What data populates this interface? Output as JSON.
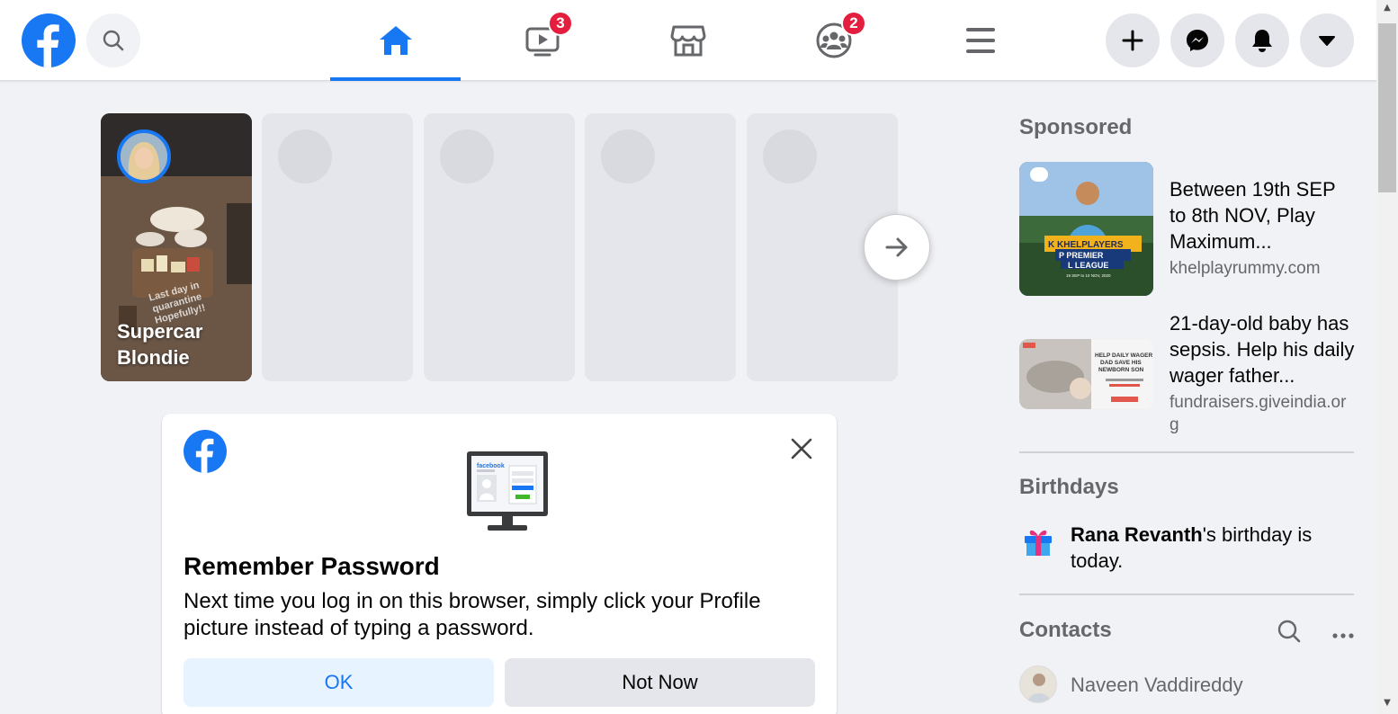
{
  "topbar": {
    "badges": {
      "watch": "3",
      "groups": "2"
    },
    "accent_color": "#1877f2",
    "badge_color": "#e41e3f"
  },
  "stories": {
    "first": {
      "name": "Supercar Blondie",
      "caption": "Last day in quarantine Hopefully!!"
    }
  },
  "card": {
    "title": "Remember Password",
    "body": "Next time you log in on this browser, simply click your Profile picture instead of typing a password.",
    "ok_label": "OK",
    "not_now_label": "Not Now",
    "illustration_brand": "facebook"
  },
  "sponsored": {
    "title": "Sponsored",
    "ads": [
      {
        "title": "Between 19th SEP to 8th NOV, Play Maximum...",
        "domain": "khelplayrummy.com",
        "img_lines": [
          "K KHELPLAYERS",
          "P PREMIER",
          "L LEAGUE",
          "19 SEP to 10 NOV, 2020"
        ]
      },
      {
        "title": "21-day-old baby has sepsis. Help his daily wager father...",
        "domain": "fundraisers.giveindia.org",
        "img_lines": [
          "HELP DAILY WAGER",
          "DAD SAVE HIS",
          "NEWBORN SON"
        ]
      }
    ]
  },
  "birthdays": {
    "title": "Birthdays",
    "name": "Rana Revanth",
    "text": "'s birthday is today."
  },
  "contacts": {
    "title": "Contacts",
    "items": [
      {
        "name": "Naveen Vaddireddy"
      }
    ]
  }
}
